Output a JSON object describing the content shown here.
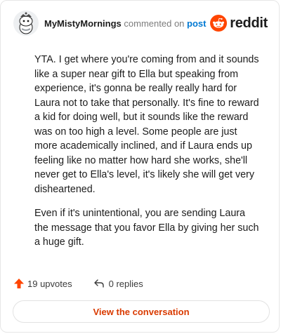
{
  "header": {
    "username": "MyMistyMornings",
    "action_text": "commented on",
    "target_text": "post",
    "brand": "reddit"
  },
  "comment": {
    "paragraphs": [
      "YTA. I get where you're coming from and it sounds like a super near gift to Ella but speaking from experience, it's gonna be really really hard for Laura not to take that personally. It's fine to reward a kid for doing well, but it sounds like the reward was on too high a level. Some people are just more academically inclined, and if Laura ends up feeling like no matter how hard she works, she'll never get to Ella's level, it's likely she will get very disheartened.",
      "Even if it's unintentional, you are sending Laura the message that you favor Ella by giving her such a huge gift."
    ]
  },
  "actions": {
    "upvotes": "19 upvotes",
    "replies": "0 replies"
  },
  "cta": {
    "label": "View the conversation"
  },
  "colors": {
    "brand": "#ff4500",
    "upvote": "#ff4500",
    "link": "#0079d3",
    "cta": "#d93a00"
  },
  "icons": {
    "avatar": "snoo-avatar-icon",
    "brand": "reddit-logo-icon",
    "upvote": "upvote-arrow-icon",
    "reply": "reply-arrow-icon"
  }
}
